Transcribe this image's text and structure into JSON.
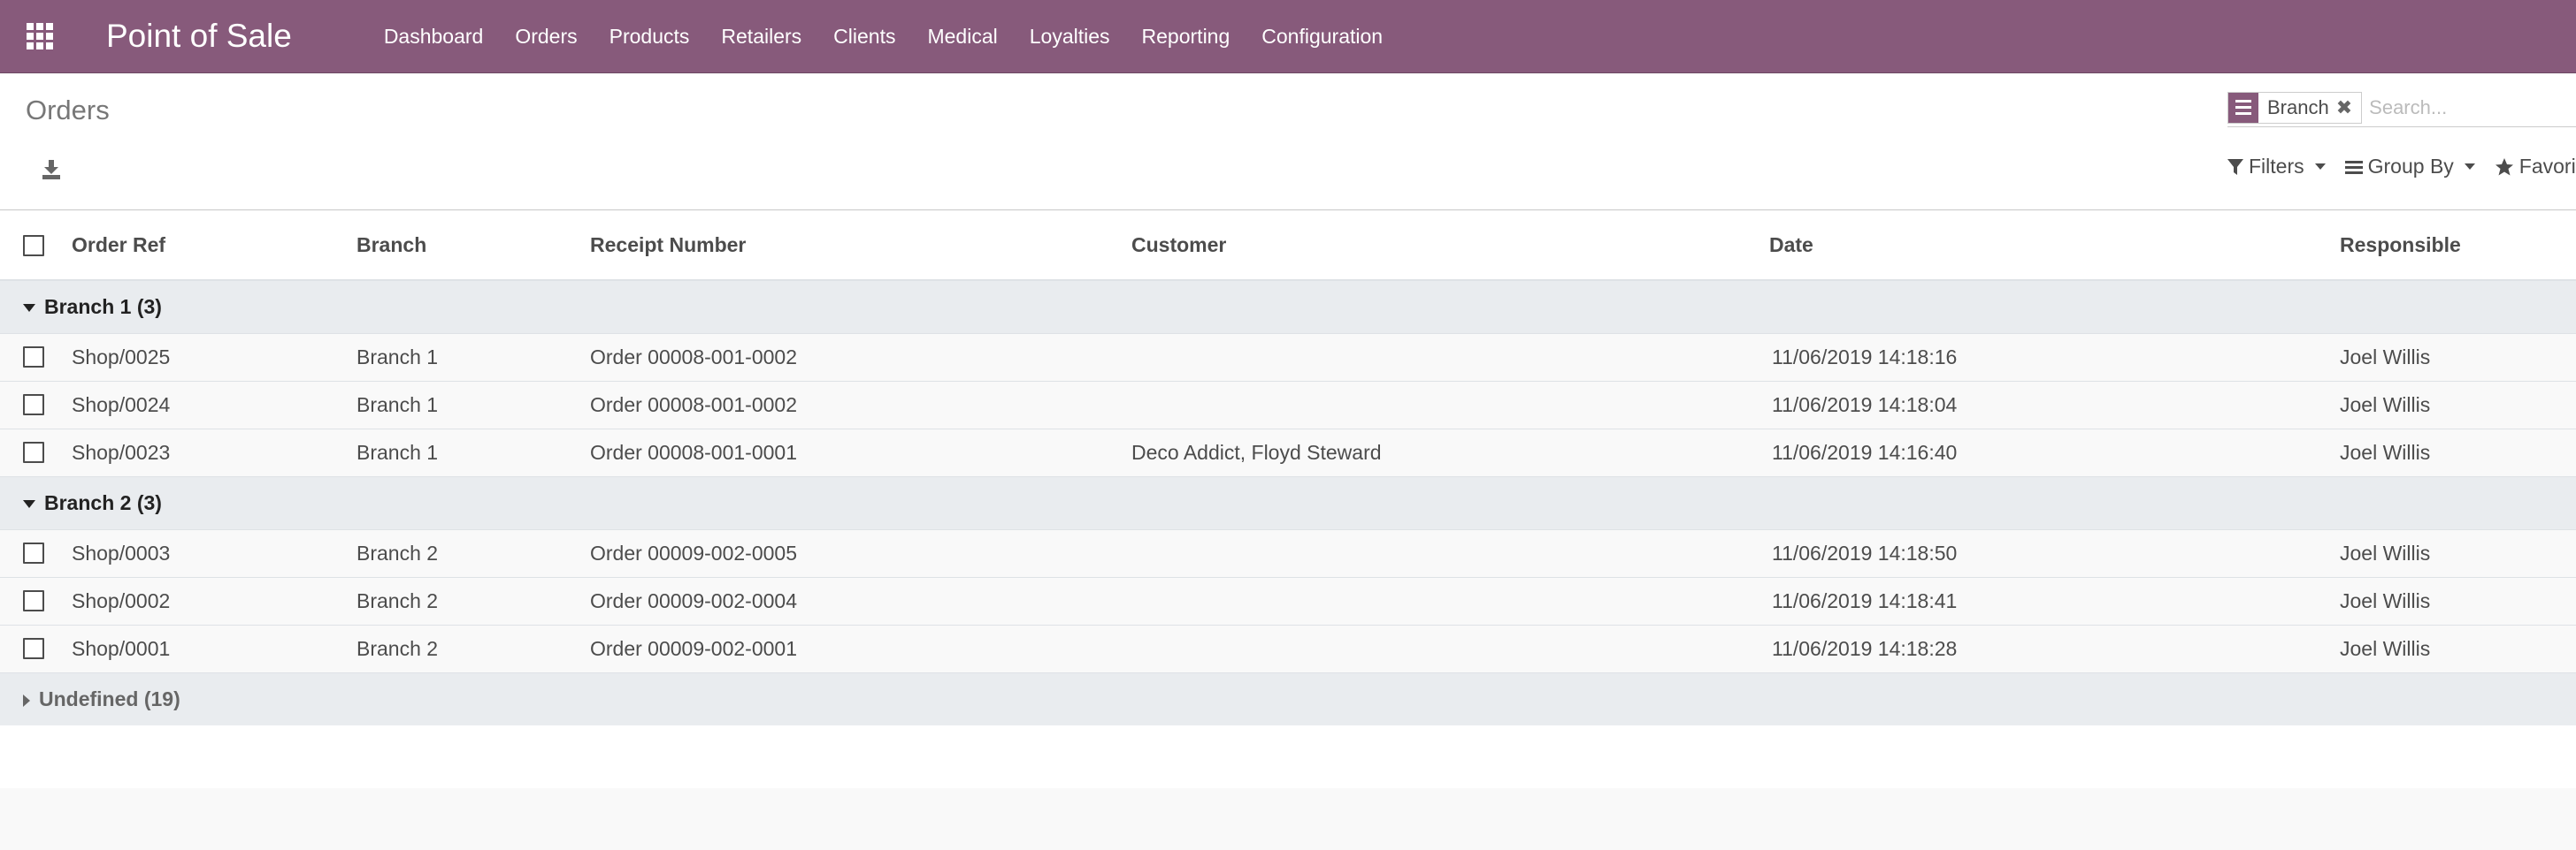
{
  "navbar": {
    "app_title": "Point of Sale",
    "menu": [
      "Dashboard",
      "Orders",
      "Products",
      "Retailers",
      "Clients",
      "Medical",
      "Loyalties",
      "Reporting",
      "Configuration"
    ],
    "icons": {
      "apps": "apps-grid-icon"
    },
    "colors": {
      "brand": "#875a7b"
    }
  },
  "control_panel": {
    "title": "Orders",
    "export_icon": "download-icon",
    "search": {
      "facet_label": "Branch",
      "facet_icon": "group-by-list-icon",
      "remove_icon": "close-icon",
      "placeholder": "Search..."
    },
    "buttons": {
      "filters": "Filters",
      "group_by": "Group By",
      "favorites": "Favorites"
    }
  },
  "list": {
    "columns": {
      "order_ref": "Order Ref",
      "branch": "Branch",
      "receipt": "Receipt Number",
      "customer": "Customer",
      "date": "Date",
      "responsible": "Responsible"
    },
    "groups": [
      {
        "label": "Branch 1 (3)",
        "expanded": true,
        "rows": [
          {
            "ref": "Shop/0025",
            "branch": "Branch 1",
            "receipt": "Order 00008-001-0002",
            "customer": "",
            "date": "11/06/2019 14:18:16",
            "responsible": "Joel Willis"
          },
          {
            "ref": "Shop/0024",
            "branch": "Branch 1",
            "receipt": "Order 00008-001-0002",
            "customer": "",
            "date": "11/06/2019 14:18:04",
            "responsible": "Joel Willis"
          },
          {
            "ref": "Shop/0023",
            "branch": "Branch 1",
            "receipt": "Order 00008-001-0001",
            "customer": "Deco Addict, Floyd Steward",
            "date": "11/06/2019 14:16:40",
            "responsible": "Joel Willis"
          }
        ]
      },
      {
        "label": "Branch 2 (3)",
        "expanded": true,
        "rows": [
          {
            "ref": "Shop/0003",
            "branch": "Branch 2",
            "receipt": "Order 00009-002-0005",
            "customer": "",
            "date": "11/06/2019 14:18:50",
            "responsible": "Joel Willis"
          },
          {
            "ref": "Shop/0002",
            "branch": "Branch 2",
            "receipt": "Order 00009-002-0004",
            "customer": "",
            "date": "11/06/2019 14:18:41",
            "responsible": "Joel Willis"
          },
          {
            "ref": "Shop/0001",
            "branch": "Branch 2",
            "receipt": "Order 00009-002-0001",
            "customer": "",
            "date": "11/06/2019 14:18:28",
            "responsible": "Joel Willis"
          }
        ]
      },
      {
        "label": "Undefined (19)",
        "expanded": false,
        "rows": []
      }
    ]
  }
}
